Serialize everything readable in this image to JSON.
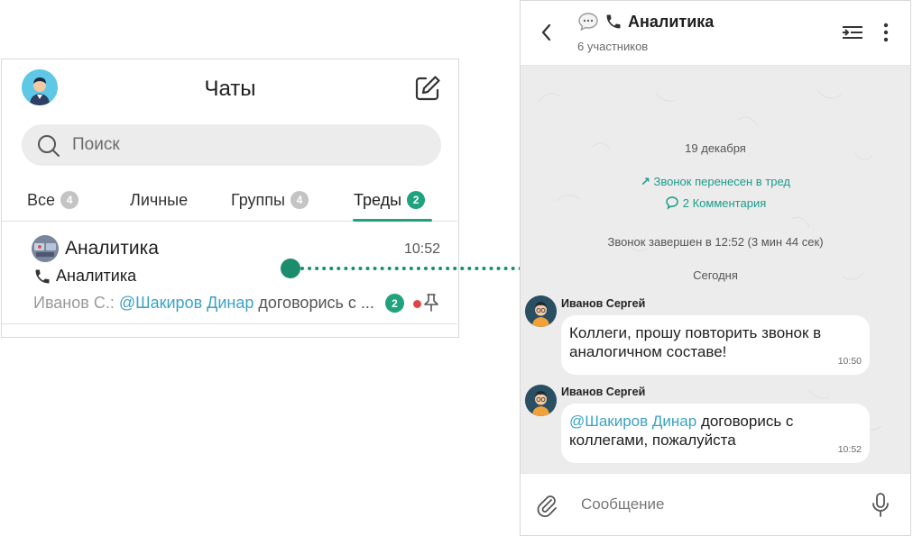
{
  "chat_list": {
    "title": "Чаты",
    "search": {
      "placeholder": "Поиск"
    },
    "tabs": [
      {
        "label": "Все",
        "badge": "4",
        "active": false
      },
      {
        "label": "Личные",
        "badge": "",
        "active": false
      },
      {
        "label": "Группы",
        "badge": "4",
        "active": false
      },
      {
        "label": "Треды",
        "badge": "2",
        "active": true
      }
    ],
    "chat": {
      "title": "Аналитика",
      "time": "10:52",
      "subtitle": "Аналитика",
      "preview_author": "Иванов С.:",
      "preview_mention": "@Шакиров Динар",
      "preview_body": "договорись с ...",
      "unread": "2"
    }
  },
  "thread": {
    "title": "Аналитика",
    "subtitle": "6 участников",
    "date_1": "19 декабря",
    "call_moved": "Звонок перенесен в тред",
    "comments": "2 Комментария",
    "call_ended": "Звонок завершен в 12:52 (3 мин 44 сек)",
    "date_2": "Сегодня",
    "messages": [
      {
        "author": "Иванов Сергей",
        "text": "Коллеги, прошу повторить звонок в аналогичном составе!",
        "mention": "",
        "time": "10:50"
      },
      {
        "author": "Иванов Сергей",
        "text": "договорись с коллегами, пожалуйста",
        "mention": "@Шакиров Динар",
        "time": "10:52"
      }
    ],
    "composer_placeholder": "Сообщение"
  },
  "colors": {
    "accent": "#1fa27d",
    "mention": "#3ba2c4",
    "unread_dot": "#e04646",
    "feed_bg": "#ececec"
  }
}
